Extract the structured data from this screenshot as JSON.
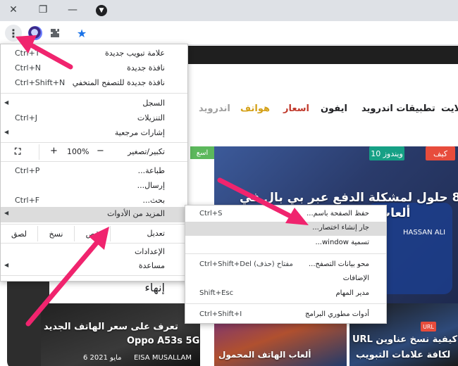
{
  "titlebar": {
    "close_glyph": "✕",
    "restore_glyph": "❐",
    "minimize_glyph": "—"
  },
  "toolbar": {
    "kebab_glyph": "⋮",
    "puzzle_glyph": "✱",
    "star_glyph": "★"
  },
  "site": {
    "nav": [
      {
        "label": "لايت",
        "color": "#1f1f1f"
      },
      {
        "label": "تطبيقات اندرويد",
        "color": "#1f1f1f"
      },
      {
        "label": "ايفون",
        "color": "#1f1f1f"
      },
      {
        "label": "اسعار",
        "color": "#c0392b"
      },
      {
        "label": "هواتف",
        "color": "#d4a017"
      },
      {
        "label": "اندرويد",
        "color": "#9e9e9e"
      }
    ],
    "tags": {
      "kif": "كيف",
      "windows10": "ويندوز 10",
      "asaar": "اسع"
    },
    "main_headline_1": "8 حلول لمشكلة الدفع عبر بي بال في",
    "main_headline_2": "ألعاب Steam",
    "main_author": "HASSAN ALI",
    "card1_headline_1": "تعرف على سعر الهاتف الجديد",
    "card1_headline_2": "Oppo A53s 5G",
    "card1_date": "6 مايو 2021",
    "card1_author": "EISA MUSALLAM",
    "card2_headline": "ألعاب الهاتف المحمول",
    "card3_headline_1": "كيفية نسخ عناوين URL",
    "card3_headline_2": "لكافة علامات التبويب",
    "card3_tag": "URL"
  },
  "menu": {
    "new_tab": "علامة تبويب جديدة",
    "new_tab_sc": "Ctrl+T",
    "new_window": "نافذة جديدة",
    "new_window_sc": "Ctrl+N",
    "incognito": "نافذة جديدة للتصفح المتخفي",
    "incognito_sc": "Ctrl+Shift+N",
    "history": "السجل",
    "downloads": "التنزيلات",
    "downloads_sc": "Ctrl+J",
    "bookmarks": "إشارات مرجعية",
    "zoom_label": "تكبير/تصغير",
    "zoom_plus": "+",
    "zoom_value": "100%",
    "zoom_minus": "−",
    "zoom_full": "⛶",
    "print": "طباعة...",
    "print_sc": "Ctrl+P",
    "cast": "إرسال...",
    "find": "بحث...",
    "find_sc": "Ctrl+F",
    "more_tools": "المزيد من الأدوات",
    "edit_label": "تعديل",
    "cut": "قص",
    "copy": "نسخ",
    "paste": "لصق",
    "settings": "الإعدادات",
    "help": "مساعدة",
    "exit": "إنهاء",
    "submenu_arrow": "◀"
  },
  "submenu": {
    "save_page": "حفظ الصفحة باسم...",
    "save_page_sc": "Ctrl+S",
    "create_shortcut": "جار إنشاء اختصار...",
    "name_window": "تسمية window...",
    "clear_data": "محو بيانات التصفح...",
    "clear_data_sc": "Ctrl+Shift+Del (حذف) مفتاح",
    "extensions": "الإضافات",
    "task_manager": "مدير المهام",
    "task_manager_sc": "Shift+Esc",
    "dev_tools": "أدوات مطوري البرامج",
    "dev_tools_sc": "Ctrl+Shift+I"
  },
  "colors": {
    "arrow": "#f0246e",
    "highlight": "#dcdcdc"
  }
}
